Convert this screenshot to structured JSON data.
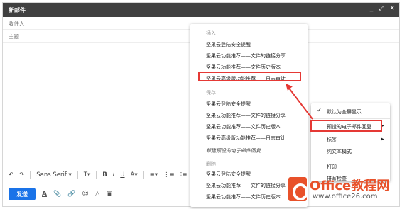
{
  "window": {
    "title": "新邮件",
    "controls": [
      "_",
      "⤢",
      "✕"
    ]
  },
  "fields": {
    "to": "收件人",
    "subject": "主题"
  },
  "toolbar": {
    "undo": "↶",
    "redo": "↷",
    "font": "Sans Serif ▾",
    "size": "T▾",
    "bold": "B",
    "italic": "I",
    "underline": "U",
    "color": "A▾",
    "align": "≡▾",
    "numbered": "⋮≡",
    "bulleted": "⁝≡",
    "indent": "⇥"
  },
  "bottom": {
    "send": "发送",
    "format": "A",
    "attach": "📎",
    "link": "🔗",
    "emoji": "☺",
    "drive": "△",
    "photo": "▣"
  },
  "menu_insert": {
    "header": "插入",
    "items": [
      "坚果云登陆安全提醒",
      "坚果云功能推荐——文件的链接分享",
      "坚果云功能推荐——文件历史版本",
      "坚果云高级版功能推荐——日志审计"
    ]
  },
  "menu_save": {
    "header": "保存",
    "items": [
      "坚果云登陆安全提醒",
      "坚果云功能推荐——文件的链接分享",
      "坚果云功能推荐——文件历史版本",
      "坚果云高级版功能推荐——日志审计"
    ],
    "new_item": "新建预设的电子邮件回复..."
  },
  "menu_delete": {
    "header": "删除",
    "items": [
      "坚果云登陆安全提醒",
      "坚果云功能推荐——文件的链接分享",
      "坚果云功能推荐——文件历史版本"
    ]
  },
  "menu_more": {
    "fullscreen": "默认为全屏显示",
    "canned": "预设的电子邮件回复",
    "label": "标签",
    "plaintext": "纯文本模式",
    "print": "打印",
    "spellcheck": "拼写检查"
  },
  "logo": {
    "brand": "Office教程网",
    "url": "www.office26.com"
  },
  "colors": {
    "accent": "#1a73e8",
    "highlight": "#e53935",
    "titlebar": "#404040",
    "brand": "#e8512a"
  }
}
